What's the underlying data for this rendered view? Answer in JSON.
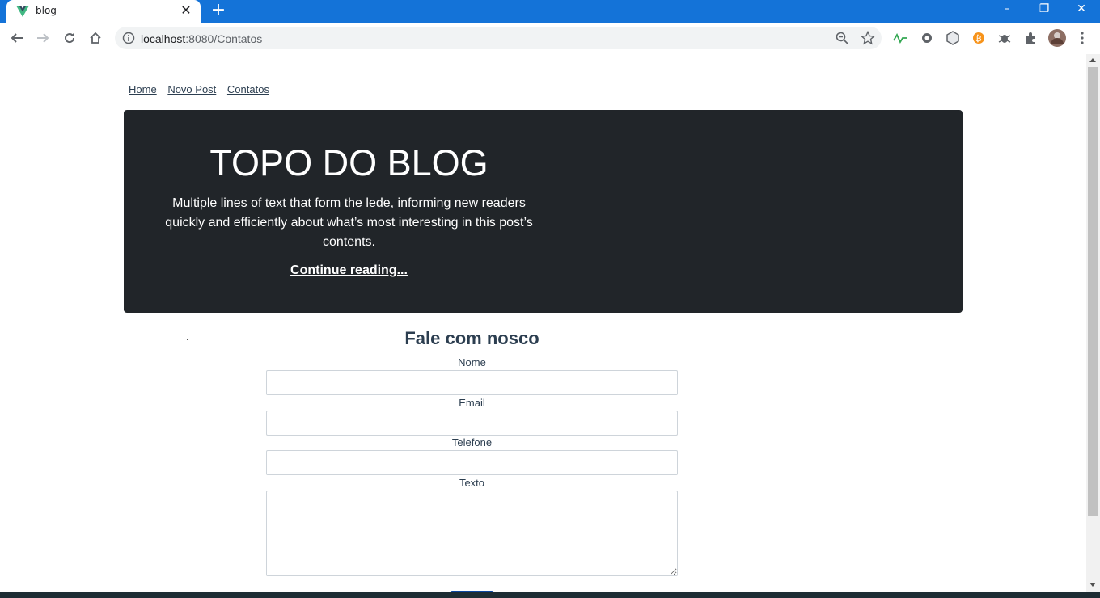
{
  "browser": {
    "tab_title": "blog",
    "url_host": "localhost",
    "url_port": ":8080",
    "url_path": "/Contatos",
    "colors": {
      "tabbar": "#1473d8",
      "omnibox": "#f1f3f4"
    },
    "icons": [
      "back-icon",
      "forward-icon",
      "reload-icon",
      "home-icon",
      "info-icon",
      "zoom-icon",
      "star-icon",
      "puzzle-icon",
      "menu-icon"
    ]
  },
  "nav": {
    "links": [
      "Home",
      "Novo Post",
      "Contatos"
    ]
  },
  "hero": {
    "title": "TOPO DO BLOG",
    "lede": "Multiple lines of text that form the lede, informing new readers quickly and efficiently about what’s most interesting in this post’s contents.",
    "link": "Continue reading...",
    "background": "#212529"
  },
  "form": {
    "title": "Fale com nosco",
    "fields": {
      "nome": {
        "label": "Nome",
        "value": ""
      },
      "email": {
        "label": "Email",
        "value": ""
      },
      "telefone": {
        "label": "Telefone",
        "value": ""
      },
      "texto": {
        "label": "Texto",
        "value": ""
      }
    }
  }
}
